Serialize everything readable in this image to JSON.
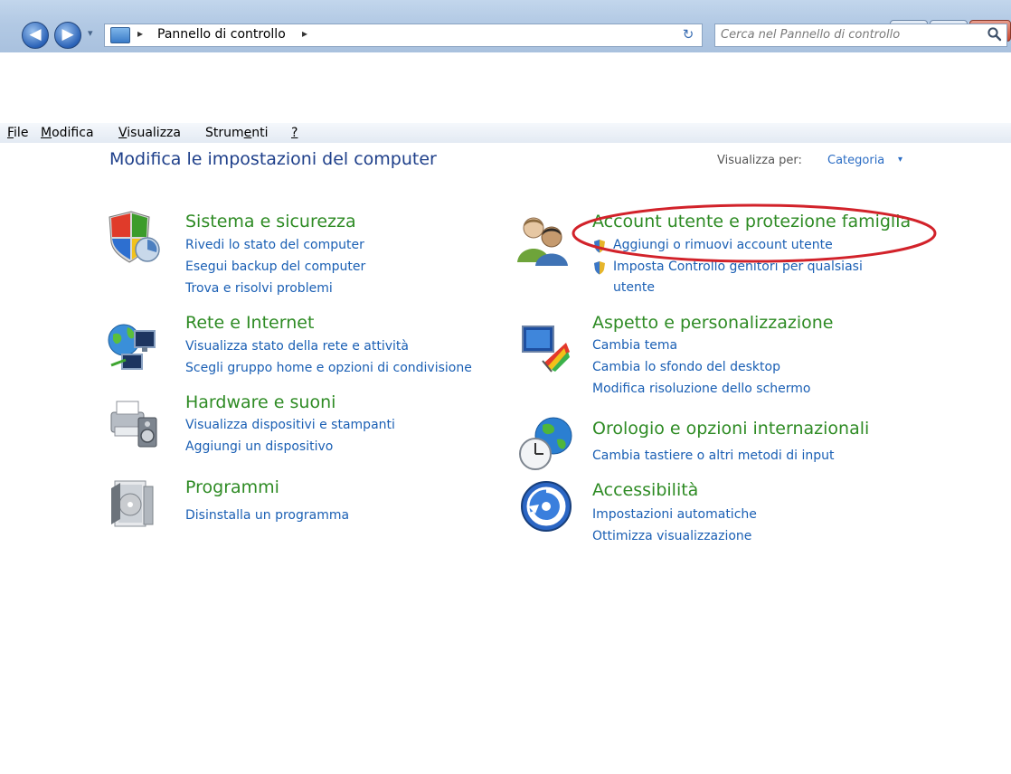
{
  "window": {
    "caption": {
      "minimize": "—",
      "maximize": "□",
      "close": "✕"
    }
  },
  "nav": {
    "back_glyph": "◀",
    "forward_glyph": "▶",
    "breadcrumb": [
      "Pannello di controllo"
    ],
    "crumb_sep": "▸",
    "dropdown_glyph": "▾",
    "refresh_glyph": "↻",
    "search": {
      "placeholder": "Cerca nel Pannello di controllo"
    }
  },
  "menubar": {
    "items": [
      {
        "accel": "F",
        "rest": "ile"
      },
      {
        "accel": "M",
        "rest": "odifica"
      },
      {
        "accel": "V",
        "rest": "isualizza"
      },
      {
        "pre": "Strum",
        "accel": "e",
        "rest": "nti"
      },
      {
        "accel": "?",
        "rest": ""
      }
    ]
  },
  "main": {
    "title": "Modifica le impostazioni del computer",
    "view_by_label": "Visualizza per:",
    "view_by_value": "Categoria"
  },
  "categories": [
    {
      "title": "Sistema e sicurezza",
      "icon": "shield-icon",
      "links": [
        "Rivedi lo stato del computer",
        "Esegui backup del computer",
        "Trova e risolvi problemi"
      ]
    },
    {
      "title": "Rete e Internet",
      "icon": "network-globe-icon",
      "links": [
        "Visualizza stato della rete e attività",
        "Scegli gruppo home e opzioni di condivisione"
      ]
    },
    {
      "title": "Hardware e suoni",
      "icon": "printer-speaker-icon",
      "links": [
        "Visualizza dispositivi e stampanti",
        "Aggiungi un dispositivo"
      ]
    },
    {
      "title": "Programmi",
      "icon": "programs-icon",
      "links": [
        "Disinstalla un programma"
      ]
    },
    {
      "title": "Account utente e protezione famiglia",
      "icon": "users-icon",
      "links": [
        "Aggiungi o rimuovi account utente",
        "Imposta Controllo genitori per qualsiasi",
        "utente"
      ]
    },
    {
      "title": "Aspetto e personalizzazione",
      "icon": "appearance-icon",
      "links": [
        "Cambia tema",
        "Cambia lo sfondo del desktop",
        "Modifica risoluzione dello schermo"
      ]
    },
    {
      "title": "Orologio e opzioni internazionali",
      "icon": "clock-globe-icon",
      "links": [
        "Cambia tastiere o altri metodi di input"
      ]
    },
    {
      "title": "Accessibilità",
      "icon": "accessibility-icon",
      "links": [
        "Impostazioni automatiche",
        "Ottimizza visualizzazione"
      ]
    }
  ],
  "colors": {
    "category_title": "#2e8b24",
    "link": "#1a5fb4",
    "highlight_ellipse": "#d2222a"
  }
}
